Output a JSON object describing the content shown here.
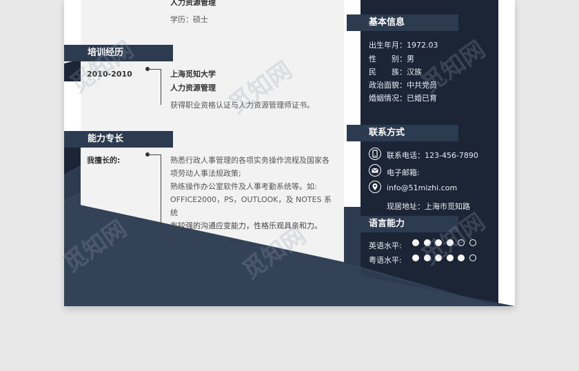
{
  "education": {
    "major_top": "人力资源管理",
    "degree": "学历：硕士"
  },
  "training": {
    "heading": "培训经历",
    "date": "2010-2010",
    "school": "上海觅知大学",
    "major": "人力资源管理",
    "desc": "获得职业资格认证与人力资源管理师证书。"
  },
  "skills": {
    "heading": "能力专长",
    "label": "我擅长的:",
    "lines": [
      "熟悉行政人事管理的各项实务操作流程及国家各",
      "项劳动人事法规政策;",
      "熟练操作办公室软件及人事考勤系统等。如:",
      "OFFICE2000，PS，OUTLOOK，及 NOTES 系",
      "统",
      "有较强的沟通应变能力，性格乐观具亲和力。"
    ]
  },
  "basic": {
    "heading": "基本信息",
    "rows": [
      "出生年月：1972.03",
      "性　　别：男",
      "民　　族：汉族",
      "政治面貌：中共党员",
      "婚姻情况：已婚已育"
    ]
  },
  "contact": {
    "heading": "联系方式",
    "phone": "联系电话：123-456-7890",
    "email_label": "电子邮箱:",
    "email": "info@51mizhi.com",
    "address": "现居地址：上海市觅知路",
    "icons": [
      "phone-icon",
      "mail-icon",
      "location-icon"
    ]
  },
  "language": {
    "heading": "语言能力",
    "items": [
      {
        "label": "英语水平:",
        "level": 4,
        "max": 6
      },
      {
        "label": "粤语水平:",
        "level": 5,
        "max": 6
      }
    ]
  },
  "watermark": "觅知网",
  "colors": {
    "navy": "#1b2535",
    "header": "#2d3b50",
    "paper": "#f2f2f2"
  }
}
